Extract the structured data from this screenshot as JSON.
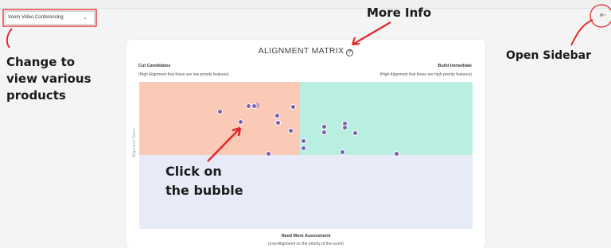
{
  "product_selector": {
    "value": "Voom Video Conferencing",
    "icon": "chevron-down-icon"
  },
  "sidebar_toggle": {
    "icon": "arrow-left-bar-icon"
  },
  "matrix": {
    "title": "ALIGNMENT MATRIX",
    "help_icon": "question-circle-icon",
    "top_left": {
      "title": "Cut Candidates",
      "subtitle": "(High Alignment that these are low priority features)"
    },
    "top_right": {
      "title": "Build Immediate",
      "subtitle": "(High Alignment that these are high priority features)"
    },
    "bottom": {
      "title": "Need More Assessment",
      "subtitle": "(Low Alignment on the priority of the score)"
    },
    "y_axis_label": "Alignment Score",
    "colors": {
      "top_left": "#fbcab6",
      "top_right": "#b8efe1",
      "bottom": "#e6ebf7",
      "bubble": "#7d5fb0"
    }
  },
  "annotations": {
    "more_info": "More Info",
    "change_view": [
      "Change to",
      "view various",
      "products"
    ],
    "open_sidebar": "Open Sidebar",
    "click_bubble": [
      "Click on",
      "the bubble"
    ]
  }
}
